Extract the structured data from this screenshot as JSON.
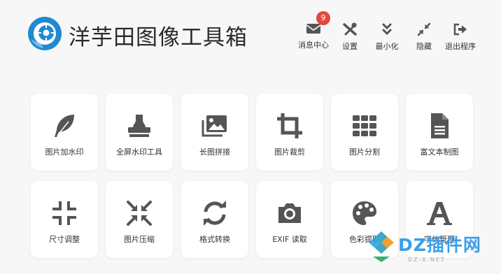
{
  "app": {
    "title": "洋芋田图像工具箱"
  },
  "toolbar": {
    "messages": {
      "label": "消息中心",
      "badge": "9",
      "icon": "envelope-icon"
    },
    "settings": {
      "label": "设置",
      "icon": "tools-icon"
    },
    "minimize": {
      "label": "最小化",
      "icon": "double-chevron-down-icon"
    },
    "hide": {
      "label": "隐藏",
      "icon": "compress-arrows-icon"
    },
    "exit": {
      "label": "退出程序",
      "icon": "sign-out-icon"
    }
  },
  "tools": [
    {
      "label": "图片加水印",
      "icon": "feather-icon"
    },
    {
      "label": "全屏水印工具",
      "icon": "stamp-icon"
    },
    {
      "label": "长图拼接",
      "icon": "images-icon"
    },
    {
      "label": "图片裁剪",
      "icon": "crop-icon"
    },
    {
      "label": "图片分割",
      "icon": "grid-icon"
    },
    {
      "label": "富文本制图",
      "icon": "document-icon"
    },
    {
      "label": "尺寸调整",
      "icon": "compress-icon"
    },
    {
      "label": "图片压缩",
      "icon": "compress-arrows-icon"
    },
    {
      "label": "格式转换",
      "icon": "sync-icon"
    },
    {
      "label": "EXIF 读取",
      "icon": "camera-icon"
    },
    {
      "label": "色彩提取",
      "icon": "palette-icon"
    },
    {
      "label": "字体管理",
      "icon": "font-icon"
    }
  ],
  "watermark": {
    "text": "DZ插件网",
    "subtext": "DZ-X.NET"
  },
  "colors": {
    "icon": "#555555",
    "accent": "#1f8ad2",
    "badge": "#e04a3b",
    "watermark": "#3a9ee8"
  }
}
